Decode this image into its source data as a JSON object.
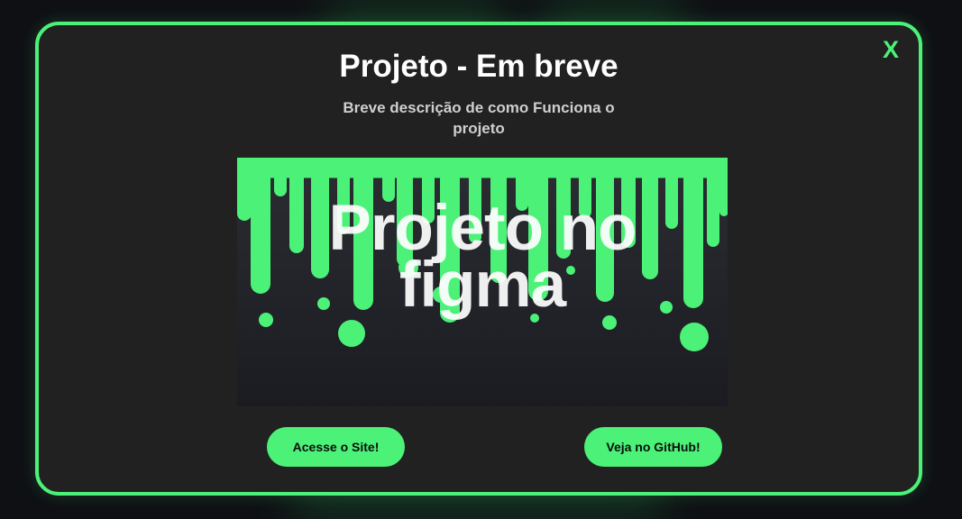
{
  "modal": {
    "close_label": "X",
    "title": "Projeto - Em breve",
    "description": "Breve descrição de como Funciona o projeto",
    "preview_text": "Projeto no figma",
    "buttons": {
      "site_label": "Acesse o Site!",
      "github_label": "Veja no GitHub!"
    }
  },
  "colors": {
    "accent": "#4cf178",
    "modal_bg": "#212121",
    "page_bg": "#0f1014"
  },
  "icons": {
    "preview_art": "slime-drip-art"
  }
}
